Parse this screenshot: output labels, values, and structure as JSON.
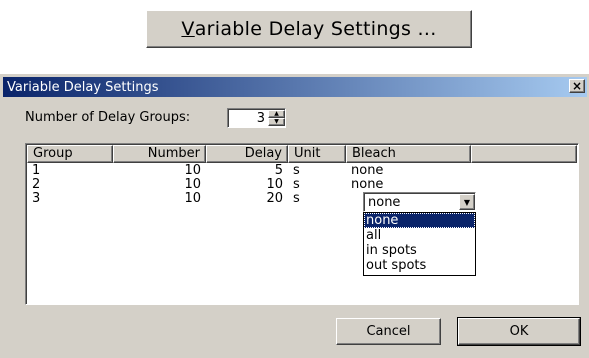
{
  "launcher": {
    "label_first": "V",
    "label_rest": "ariable Delay Settings ..."
  },
  "dialog": {
    "title": "Variable Delay Settings",
    "close_glyph": "×",
    "num_groups_label": "Number of Delay Groups:",
    "num_groups_value": "3",
    "columns": [
      "Group",
      "Number",
      "Delay",
      "Unit",
      "Bleach"
    ],
    "rows": [
      {
        "group": "1",
        "number": "10",
        "delay": "5",
        "unit": "s",
        "bleach": "none"
      },
      {
        "group": "2",
        "number": "10",
        "delay": "10",
        "unit": "s",
        "bleach": "none"
      },
      {
        "group": "3",
        "number": "10",
        "delay": "20",
        "unit": "s",
        "bleach": ""
      }
    ],
    "bleach_combo": {
      "value": "none",
      "options": [
        "none",
        "all",
        "in spots",
        "out spots"
      ],
      "highlighted": "none"
    },
    "cancel_label": "Cancel",
    "ok_label": "OK"
  },
  "colors": {
    "face": "#d4d0c8",
    "title_start": "#0a246a",
    "title_end": "#a6caf0",
    "highlight": "#0a246a"
  },
  "icons": {
    "spin_up": "up-arrow-icon",
    "spin_down": "down-arrow-icon",
    "combo": "chevron-down-icon",
    "close": "close-icon"
  }
}
